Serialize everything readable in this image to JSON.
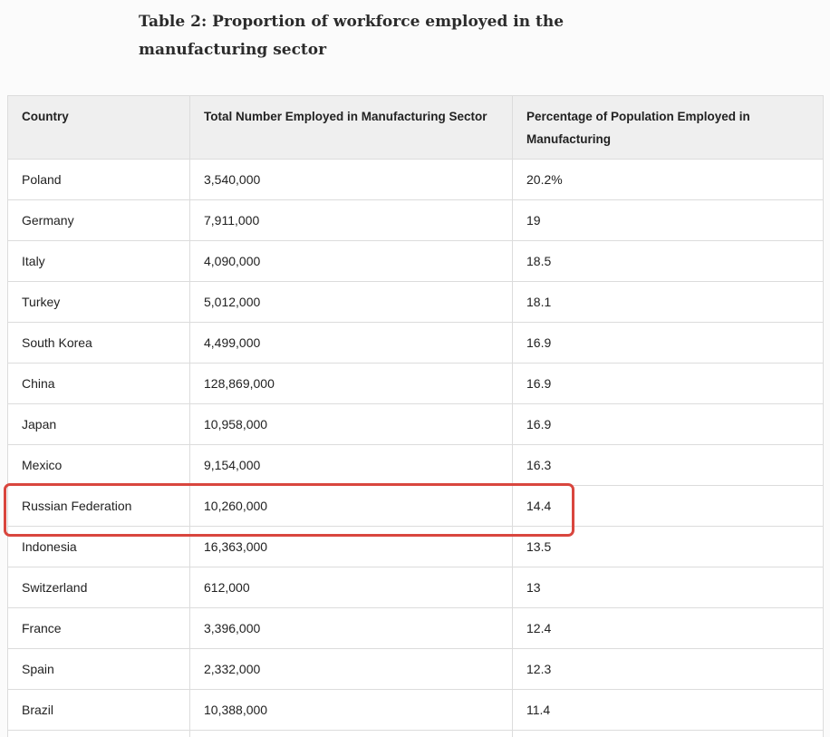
{
  "title": "Table 2: Proportion of workforce employed in the manufacturing sector",
  "table": {
    "headers": [
      "Country",
      "Total Number Employed in Manufacturing Sector",
      "Percentage of Population Employed in Manufacturing"
    ],
    "rows": [
      [
        "Poland",
        "3,540,000",
        "20.2%"
      ],
      [
        "Germany",
        "7,911,000",
        "19"
      ],
      [
        "Italy",
        "4,090,000",
        "18.5"
      ],
      [
        "Turkey",
        "5,012,000",
        "18.1"
      ],
      [
        "South Korea",
        "4,499,000",
        "16.9"
      ],
      [
        "China",
        "128,869,000",
        "16.9"
      ],
      [
        "Japan",
        "10,958,000",
        "16.9"
      ],
      [
        "Mexico",
        "9,154,000",
        "16.3"
      ],
      [
        "Russian Federation",
        "10,260,000",
        "14.4"
      ],
      [
        "Indonesia",
        "16,363,000",
        "13.5"
      ],
      [
        "Switzerland",
        "612,000",
        "13"
      ],
      [
        "France",
        "3,396,000",
        "12.4"
      ],
      [
        "Spain",
        "2,332,000",
        "12.3"
      ],
      [
        "Brazil",
        "10,388,000",
        "11.4"
      ],
      [
        "",
        "",
        ""
      ]
    ]
  },
  "highlight": {
    "row_index": 8,
    "color": "#d9463e"
  }
}
